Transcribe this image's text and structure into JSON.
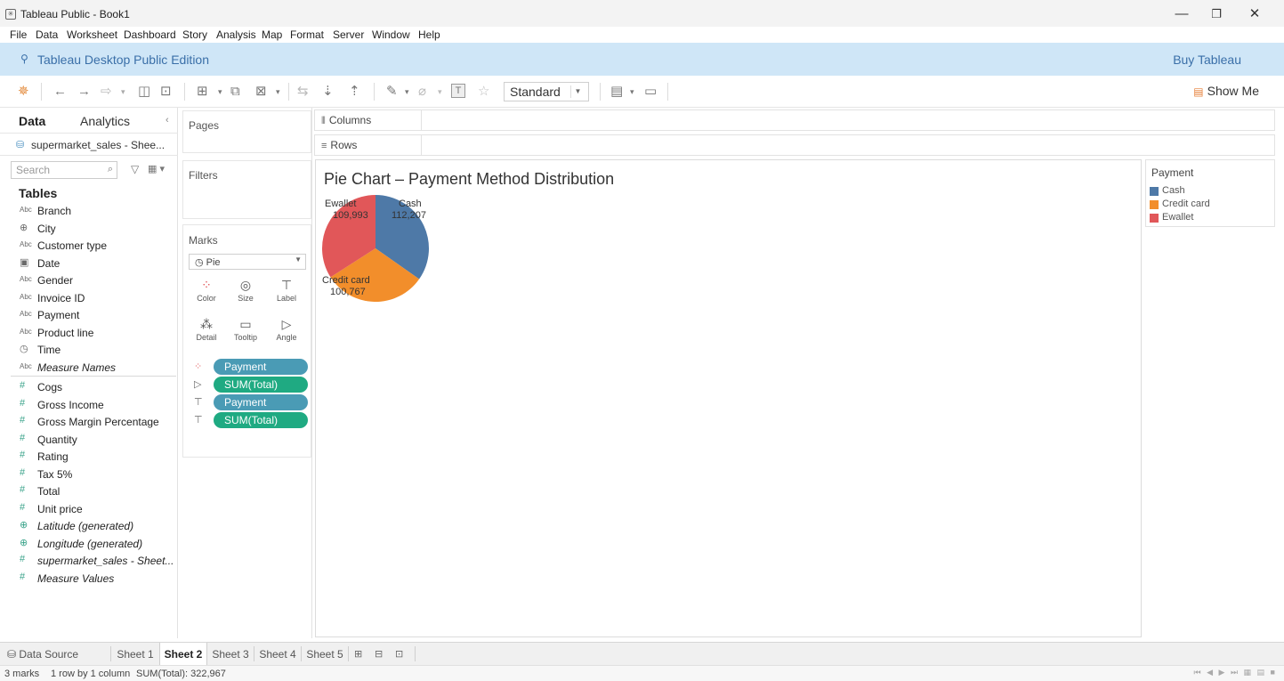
{
  "window": {
    "title": "Tableau Public - Book1",
    "minimize_glyph": "—",
    "restore_glyph": "❐",
    "close_glyph": "✕"
  },
  "menu": [
    "File",
    "Data",
    "Worksheet",
    "Dashboard",
    "Story",
    "Analysis",
    "Map",
    "Format",
    "Server",
    "Window",
    "Help"
  ],
  "banner": {
    "edition": "Tableau Desktop Public Edition",
    "buy": "Buy Tableau"
  },
  "toolbar": {
    "fit_select": "Standard",
    "show_me": "Show Me"
  },
  "data_pane": {
    "tabs": {
      "data": "Data",
      "analytics": "Analytics"
    },
    "datasource": "supermarket_sales - Shee...",
    "search_placeholder": "Search",
    "tables_heading": "Tables",
    "dimensions": [
      {
        "icon": "Abc",
        "name": "Branch"
      },
      {
        "icon": "⊕",
        "name": "City"
      },
      {
        "icon": "Abc",
        "name": "Customer type"
      },
      {
        "icon": "▣",
        "name": "Date"
      },
      {
        "icon": "Abc",
        "name": "Gender"
      },
      {
        "icon": "Abc",
        "name": "Invoice ID"
      },
      {
        "icon": "Abc",
        "name": "Payment"
      },
      {
        "icon": "Abc",
        "name": "Product line"
      },
      {
        "icon": "◷",
        "name": "Time"
      },
      {
        "icon": "Abc",
        "name": "Measure Names"
      }
    ],
    "measures": [
      {
        "icon": "#",
        "name": "Cogs"
      },
      {
        "icon": "#",
        "name": "Gross Income"
      },
      {
        "icon": "#",
        "name": "Gross Margin Percentage"
      },
      {
        "icon": "#",
        "name": "Quantity"
      },
      {
        "icon": "#",
        "name": "Rating"
      },
      {
        "icon": "#",
        "name": "Tax 5%"
      },
      {
        "icon": "#",
        "name": "Total"
      },
      {
        "icon": "#",
        "name": "Unit price"
      },
      {
        "icon": "⊕",
        "name": "Latitude (generated)"
      },
      {
        "icon": "⊕",
        "name": "Longitude (generated)"
      },
      {
        "icon": "#",
        "name": "supermarket_sales - Sheet..."
      },
      {
        "icon": "#",
        "name": "Measure Values"
      }
    ]
  },
  "shelves": {
    "pages": "Pages",
    "filters": "Filters",
    "marks": "Marks",
    "mark_type": "Pie",
    "mark_buttons": [
      "Color",
      "Size",
      "Label",
      "Detail",
      "Tooltip",
      "Angle"
    ],
    "pills": [
      {
        "field": "Payment",
        "kind": "dimension",
        "role": "color"
      },
      {
        "field": "SUM(Total)",
        "kind": "measure",
        "role": "angle"
      },
      {
        "field": "Payment",
        "kind": "dimension",
        "role": "label"
      },
      {
        "field": "SUM(Total)",
        "kind": "measure",
        "role": "label"
      }
    ],
    "columns": "Columns",
    "rows": "Rows"
  },
  "worksheet": {
    "title": "Pie Chart – Payment Method Distribution"
  },
  "chart_data": {
    "type": "pie",
    "title": "Pie Chart – Payment Method Distribution",
    "categories": [
      "Cash",
      "Credit card",
      "Ewallet"
    ],
    "values": [
      112207,
      100767,
      109993
    ],
    "value_labels": [
      "112,207",
      "100,767",
      "109,993"
    ],
    "colors": [
      "#4e79a7",
      "#f28e2b",
      "#e15759"
    ],
    "legend_title": "Payment",
    "legend_placement": "right"
  },
  "sheet_tabs": {
    "data_source": "Data Source",
    "sheets": [
      "Sheet 1",
      "Sheet 2",
      "Sheet 3",
      "Sheet 4",
      "Sheet 5"
    ],
    "active": "Sheet 2"
  },
  "status": {
    "marks": "3 marks",
    "dims": "1 row by 1 column",
    "sum": "SUM(Total): 322,967"
  }
}
